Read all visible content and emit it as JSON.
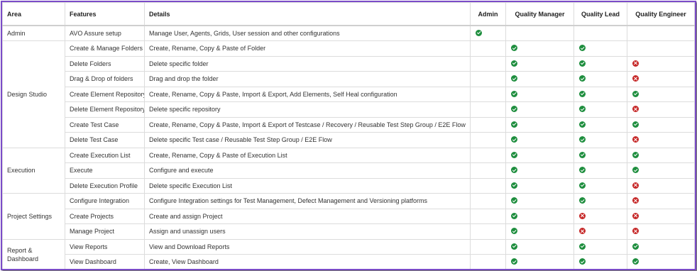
{
  "headers": {
    "area": "Area",
    "features": "Features",
    "details": "Details",
    "admin": "Admin",
    "quality_manager": "Quality Manager",
    "quality_lead": "Quality Lead",
    "quality_engineer": "Quality Engineer"
  },
  "icons": {
    "allowed": "check-circle-icon",
    "denied": "x-circle-icon",
    "allowed_color": "#1e8e3e",
    "denied_color": "#c62828"
  },
  "areas": {
    "admin": "Admin",
    "design_studio": "Design Studio",
    "execution": "Execution",
    "project_settings": "Project Settings",
    "report_dashboard": "Report & Dashboard"
  },
  "rows": [
    {
      "feature": "AVO Assure setup",
      "details": "Manage User, Agents, Grids, User session and other configurations",
      "admin": "yes",
      "qm": "",
      "ql": "",
      "qe": ""
    },
    {
      "feature": "Create & Manage Folders",
      "details": "Create, Rename, Copy & Paste of Folder",
      "admin": "",
      "qm": "yes",
      "ql": "yes",
      "qe": ""
    },
    {
      "feature": "Delete Folders",
      "details": "Delete specific folder",
      "admin": "",
      "qm": "yes",
      "ql": "yes",
      "qe": "no"
    },
    {
      "feature": "Drag & Drop of folders",
      "details": "Drag and drop the folder",
      "admin": "",
      "qm": "yes",
      "ql": "yes",
      "qe": "no"
    },
    {
      "feature": "Create Element Repository",
      "details": "Create, Rename, Copy & Paste, Import & Export, Add Elements, Self Heal configuration",
      "admin": "",
      "qm": "yes",
      "ql": "yes",
      "qe": "yes"
    },
    {
      "feature": "Delete Element Repository",
      "details": "Delete specific repository",
      "admin": "",
      "qm": "yes",
      "ql": "yes",
      "qe": "no"
    },
    {
      "feature": "Create Test Case",
      "details": "Create, Rename, Copy & Paste, Import & Export of Testcase / Recovery / Reusable Test Step Group / E2E Flow",
      "admin": "",
      "qm": "yes",
      "ql": "yes",
      "qe": "yes"
    },
    {
      "feature": "Delete Test Case",
      "details": "Delete specific Test case / Reusable Test Step Group / E2E Flow",
      "admin": "",
      "qm": "yes",
      "ql": "yes",
      "qe": "no"
    },
    {
      "feature": "Create Execution List",
      "details": "Create, Rename, Copy & Paste of Execution List",
      "admin": "",
      "qm": "yes",
      "ql": "yes",
      "qe": "yes"
    },
    {
      "feature": "Execute",
      "details": "Configure and execute",
      "admin": "",
      "qm": "yes",
      "ql": "yes",
      "qe": "yes"
    },
    {
      "feature": "Delete Execution Profile",
      "details": "Delete specific Execution List",
      "admin": "",
      "qm": "yes",
      "ql": "yes",
      "qe": "no"
    },
    {
      "feature": "Configure Integration",
      "details": "Configure Integration settings for Test Management, Defect Management and Versioning platforms",
      "admin": "",
      "qm": "yes",
      "ql": "yes",
      "qe": "no"
    },
    {
      "feature": "Create Projects",
      "details": "Create and assign Project",
      "admin": "",
      "qm": "yes",
      "ql": "no",
      "qe": "no"
    },
    {
      "feature": "Manage Project",
      "details": "Assign and unassign users",
      "admin": "",
      "qm": "yes",
      "ql": "no",
      "qe": "no"
    },
    {
      "feature": "View Reports",
      "details": "View and Download Reports",
      "admin": "",
      "qm": "yes",
      "ql": "yes",
      "qe": "yes"
    },
    {
      "feature": "View Dashboard",
      "details": "Create, View Dashboard",
      "admin": "",
      "qm": "yes",
      "ql": "yes",
      "qe": "yes"
    }
  ]
}
